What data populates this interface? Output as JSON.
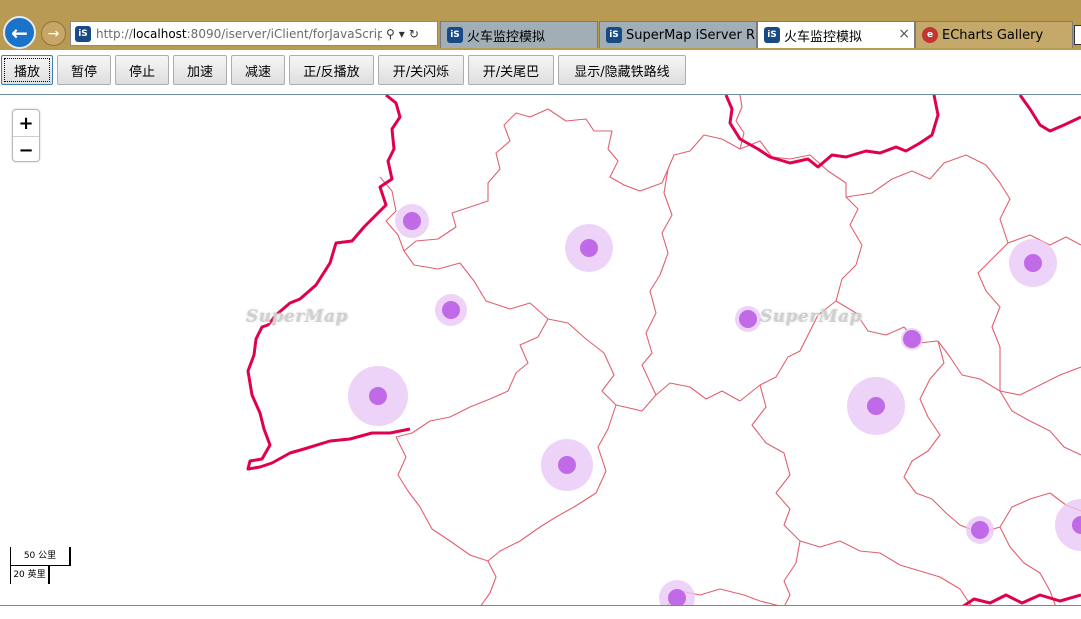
{
  "browser": {
    "address": {
      "url_prefix": "http://",
      "url_host": "localhost",
      "url_rest": ":8090/iserver/iClient/forJavaScript,",
      "search_glyph": "⚲",
      "dropdown_glyph": "▾",
      "refresh_glyph": "↻"
    },
    "back_glyph": "←",
    "forward_glyph": "→",
    "tabs": [
      {
        "label": "火车监控模拟",
        "state": "inactive",
        "icon": "iserver-icon"
      },
      {
        "label": "SuperMap iServer R...",
        "state": "inactive",
        "icon": "iserver-icon"
      },
      {
        "label": "火车监控模拟",
        "state": "active",
        "icon": "iserver-icon",
        "close_glyph": "×"
      },
      {
        "label": "ECharts Gallery",
        "state": "inactive",
        "icon": "echarts-icon"
      }
    ]
  },
  "toolbar": {
    "buttons": [
      {
        "label": "播放"
      },
      {
        "label": "暂停"
      },
      {
        "label": "停止"
      },
      {
        "label": "加速"
      },
      {
        "label": "减速"
      },
      {
        "label": "正/反播放"
      },
      {
        "label": "开/关闪烁"
      },
      {
        "label": "开/关尾巴"
      },
      {
        "label": "显示/隐藏铁路线"
      }
    ]
  },
  "map": {
    "zoom_in_label": "+",
    "zoom_out_label": "−",
    "watermark": "SuperMap",
    "scale_metric": "50 公里",
    "scale_imperial": "20 英里",
    "colors": {
      "province_border": "#e0004e",
      "county_border": "#e2606e",
      "marker_core": "#c06ae8",
      "marker_halo": "#e8c8f6"
    }
  }
}
